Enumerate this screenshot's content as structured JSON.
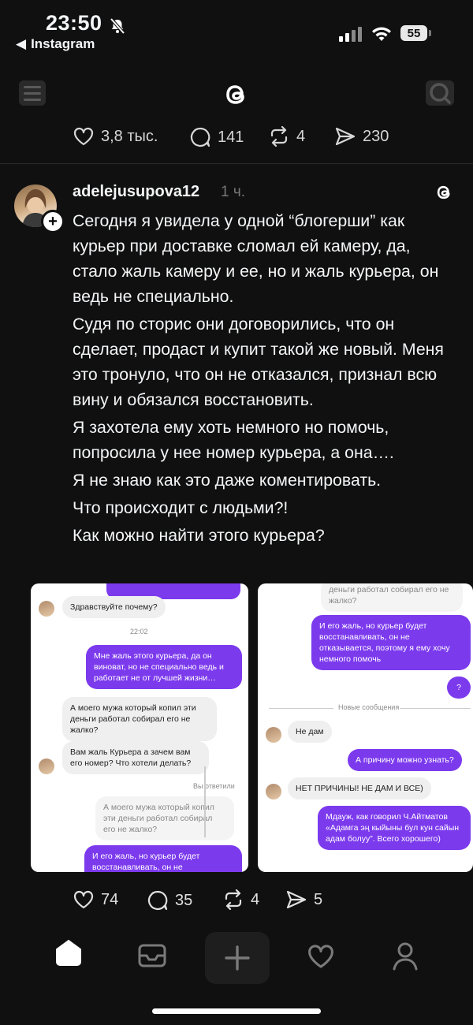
{
  "status_bar": {
    "time": "23:50",
    "back_app": "Instagram",
    "battery": "55"
  },
  "top_stats": {
    "likes": "3,8 тыс.",
    "comments": "141",
    "reposts": "4",
    "shares": "230"
  },
  "post": {
    "username": "adelejusupova12",
    "time_ago": "1 ч.",
    "paragraphs": [
      "Сегодня я увидела у одной “блогерши” как курьер при доставке сломал ей камеру, да, стало жаль камеру и ее, но и жаль курьера, он ведь не специально.",
      "Судя по сторис они договорились, что он сделает, продаст и купит такой же новый. Меня это тронуло, что он не отказался, признал всю вину и  обязался восстановить.",
      "Я захотела ему хоть немного но помочь, попросила у нее номер курьера, а она….",
      "Я не знаю как это даже коментировать.",
      "Что происходит с людьми?!",
      "Как можно найти этого курьера?"
    ],
    "shot1": {
      "msg1": "Здравствуйте почему?",
      "time": "22:02",
      "msg2": "Мне жаль этого курьера, да он виноват, но не специально ведь и работает не от лучшей жизни…",
      "msg3": "А моего мужа который копил эти деньги работал собирал его не жалко?",
      "msg4": "Вам жаль Курьера а зачем вам его номер? Что хотели делать?",
      "replied": "Вы ответили",
      "quote": "А моего мужа который копил эти деньги работал собирал его не жалко?",
      "msg5": "И его жаль, но курьер будет восстанавливать, он не"
    },
    "shot2": {
      "quote_top": "деньги работал собирал его не жалко?",
      "msg1": "И его жаль, но курьер будет восстанавливать, он не отказывается, поэтому я ему хочу немного помочь",
      "msg2": "?",
      "new_messages": "Новые сообщения",
      "msg3": "Не дам",
      "msg4": "А причину можно узнать?",
      "msg5": "НЕТ ПРИЧИНЫ! НЕ ДАМ И ВСЕ)",
      "msg6": "Мдауж, как говорил Ч.Айтматов «Адамга эң кыйыны бул кун сайын адам болуу”. Всего хорошего)"
    },
    "actions": {
      "likes": "74",
      "comments": "35",
      "reposts": "4",
      "shares": "5"
    }
  },
  "icons": {
    "like": "heart-icon",
    "comment": "comment-icon",
    "repost": "repost-icon",
    "share": "send-icon"
  }
}
